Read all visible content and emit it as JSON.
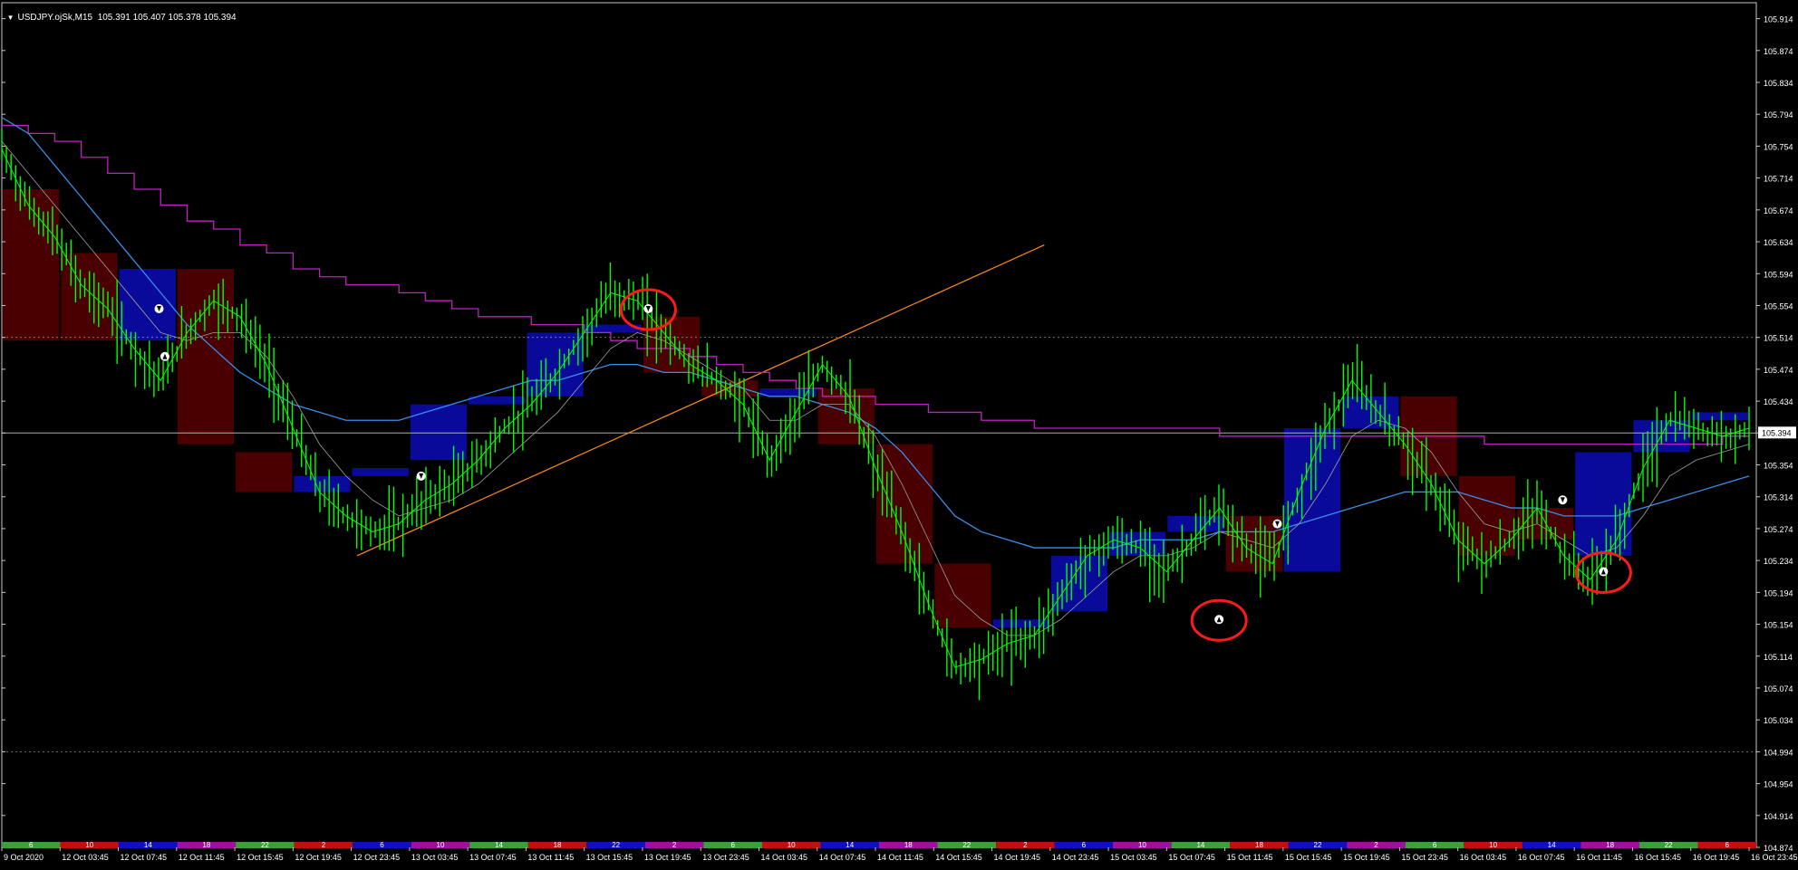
{
  "header": {
    "menu_arrow": "▼",
    "symbol": "USDJPY.ojSk,M15",
    "quote": "105.391 105.407 105.378 105.394"
  },
  "current_price_label": "105.394",
  "colors": {
    "background": "#000000",
    "frame": "#c8c8c8",
    "candle": "#00ff00",
    "bar_up": "#0a0a9a",
    "bar_down": "#4a0000",
    "pivot_line": "#c020c0",
    "blue_line": "#3a8ee8",
    "ma_line": "#a0a0a0",
    "trendline": "#ff8c1a",
    "price_line": "#c0c0c0",
    "marker_circle": "#ff1a1a",
    "session_colors": [
      "#3aa03a",
      "#c01010",
      "#1010c0",
      "#a010a0"
    ]
  },
  "session_strip_labels": [
    "6",
    "10",
    "14",
    "18",
    "22",
    "2",
    "6",
    "10",
    "14",
    "18",
    "22",
    "2",
    "6",
    "10",
    "14",
    "18",
    "22",
    "2",
    "6",
    "10",
    "14",
    "18",
    "22",
    "2",
    "6",
    "10",
    "14",
    "18",
    "22",
    "6"
  ],
  "chart_data": {
    "type": "line",
    "title": "USDJPY.ojSk,M15",
    "ohlc_current": {
      "open": 105.391,
      "high": 105.407,
      "low": 105.378,
      "close": 105.394
    },
    "y_ticks": [
      105.914,
      105.874,
      105.834,
      105.794,
      105.754,
      105.714,
      105.674,
      105.634,
      105.594,
      105.554,
      105.514,
      105.474,
      105.434,
      105.394,
      105.354,
      105.314,
      105.274,
      105.234,
      105.194,
      105.154,
      105.114,
      105.074,
      105.034,
      104.994,
      104.954,
      104.914,
      104.874
    ],
    "ylim": [
      104.874,
      105.934
    ],
    "x_ticks": [
      "9 Oct 2020",
      "12 Oct 03:45",
      "12 Oct 07:45",
      "12 Oct 11:45",
      "12 Oct 15:45",
      "12 Oct 19:45",
      "12 Oct 23:45",
      "13 Oct 03:45",
      "13 Oct 07:45",
      "13 Oct 11:45",
      "13 Oct 15:45",
      "13 Oct 19:45",
      "13 Oct 23:45",
      "14 Oct 03:45",
      "14 Oct 07:45",
      "14 Oct 11:45",
      "14 Oct 15:45",
      "14 Oct 19:45",
      "14 Oct 23:45",
      "15 Oct 03:45",
      "15 Oct 07:45",
      "15 Oct 11:45",
      "15 Oct 15:45",
      "15 Oct 19:45",
      "15 Oct 23:45",
      "16 Oct 03:45",
      "16 Oct 07:45",
      "16 Oct 11:45",
      "16 Oct 15:45",
      "16 Oct 19:45",
      "16 Oct 23:45"
    ],
    "series": [
      {
        "name": "price",
        "values": [
          105.75,
          105.68,
          105.64,
          105.58,
          105.55,
          105.5,
          105.46,
          105.52,
          105.56,
          105.54,
          105.48,
          105.4,
          105.32,
          105.29,
          105.27,
          105.28,
          105.31,
          105.33,
          105.36,
          105.4,
          105.43,
          105.47,
          105.52,
          105.57,
          105.56,
          105.52,
          105.48,
          105.46,
          105.43,
          105.36,
          105.42,
          105.48,
          105.44,
          105.35,
          105.27,
          105.18,
          105.1,
          105.11,
          105.13,
          105.14,
          105.19,
          105.24,
          105.26,
          105.25,
          105.22,
          105.26,
          105.3,
          105.25,
          105.23,
          105.32,
          105.4,
          105.46,
          105.42,
          105.38,
          105.33,
          105.26,
          105.23,
          105.26,
          105.3,
          105.24,
          105.21,
          105.26,
          105.35,
          105.41,
          105.4,
          105.39,
          105.4
        ]
      },
      {
        "name": "ma",
        "values": [
          105.76,
          105.72,
          105.68,
          105.64,
          105.6,
          105.56,
          105.52,
          105.51,
          105.52,
          105.52,
          105.49,
          105.44,
          105.38,
          105.34,
          105.31,
          105.29,
          105.3,
          105.31,
          105.33,
          105.36,
          105.39,
          105.42,
          105.46,
          105.5,
          105.52,
          105.51,
          105.49,
          105.47,
          105.45,
          105.41,
          105.41,
          105.43,
          105.43,
          105.39,
          105.33,
          105.26,
          105.19,
          105.16,
          105.14,
          105.14,
          105.16,
          105.19,
          105.22,
          105.24,
          105.24,
          105.25,
          105.27,
          105.26,
          105.25,
          105.28,
          105.33,
          105.39,
          105.41,
          105.4,
          105.37,
          105.32,
          105.28,
          105.27,
          105.28,
          105.26,
          105.24,
          105.25,
          105.29,
          105.34,
          105.36,
          105.37,
          105.38
        ]
      },
      {
        "name": "blue",
        "values": [
          105.79,
          105.77,
          105.73,
          105.69,
          105.65,
          105.61,
          105.57,
          105.53,
          105.5,
          105.47,
          105.45,
          105.43,
          105.42,
          105.41,
          105.41,
          105.41,
          105.42,
          105.43,
          105.44,
          105.45,
          105.46,
          105.46,
          105.47,
          105.48,
          105.48,
          105.47,
          105.47,
          105.46,
          105.45,
          105.44,
          105.44,
          105.43,
          105.42,
          105.4,
          105.37,
          105.33,
          105.29,
          105.27,
          105.26,
          105.25,
          105.25,
          105.25,
          105.25,
          105.26,
          105.26,
          105.26,
          105.27,
          105.27,
          105.27,
          105.28,
          105.29,
          105.3,
          105.31,
          105.32,
          105.32,
          105.32,
          105.31,
          105.3,
          105.3,
          105.29,
          105.29,
          105.29,
          105.3,
          105.31,
          105.32,
          105.33,
          105.34
        ]
      },
      {
        "name": "pivot",
        "values": [
          105.78,
          105.77,
          105.76,
          105.74,
          105.72,
          105.7,
          105.68,
          105.66,
          105.65,
          105.63,
          105.62,
          105.6,
          105.59,
          105.58,
          105.58,
          105.57,
          105.56,
          105.55,
          105.54,
          105.54,
          105.53,
          105.53,
          105.52,
          105.51,
          105.5,
          105.5,
          105.49,
          105.48,
          105.47,
          105.46,
          105.45,
          105.44,
          105.44,
          105.43,
          105.43,
          105.42,
          105.42,
          105.41,
          105.41,
          105.4,
          105.4,
          105.4,
          105.4,
          105.4,
          105.4,
          105.4,
          105.39,
          105.39,
          105.39,
          105.39,
          105.39,
          105.39,
          105.39,
          105.39,
          105.39,
          105.39,
          105.38,
          105.38,
          105.38,
          105.38,
          105.38,
          105.38,
          105.38,
          105.38,
          105.38,
          105.39,
          105.39
        ]
      }
    ],
    "session_boxes": [
      {
        "dir": "down",
        "open": 105.7,
        "close": 105.51
      },
      {
        "dir": "down",
        "open": 105.62,
        "close": 105.51
      },
      {
        "dir": "up",
        "open": 105.51,
        "close": 105.6
      },
      {
        "dir": "down",
        "open": 105.6,
        "close": 105.38
      },
      {
        "dir": "down",
        "open": 105.37,
        "close": 105.32
      },
      {
        "dir": "up",
        "open": 105.32,
        "close": 105.34
      },
      {
        "dir": "up",
        "open": 105.34,
        "close": 105.35
      },
      {
        "dir": "up",
        "open": 105.36,
        "close": 105.43
      },
      {
        "dir": "up",
        "open": 105.43,
        "close": 105.44
      },
      {
        "dir": "up",
        "open": 105.44,
        "close": 105.52
      },
      {
        "dir": "up",
        "open": 105.52,
        "close": 105.53
      },
      {
        "dir": "down",
        "open": 105.54,
        "close": 105.47
      },
      {
        "dir": "down",
        "open": 105.46,
        "close": 105.44
      },
      {
        "dir": "up",
        "open": 105.44,
        "close": 105.45
      },
      {
        "dir": "down",
        "open": 105.45,
        "close": 105.38
      },
      {
        "dir": "down",
        "open": 105.38,
        "close": 105.23
      },
      {
        "dir": "down",
        "open": 105.23,
        "close": 105.15
      },
      {
        "dir": "up",
        "open": 105.15,
        "close": 105.16
      },
      {
        "dir": "up",
        "open": 105.17,
        "close": 105.24
      },
      {
        "dir": "up",
        "open": 105.24,
        "close": 105.27
      },
      {
        "dir": "up",
        "open": 105.27,
        "close": 105.29
      },
      {
        "dir": "down",
        "open": 105.29,
        "close": 105.22
      },
      {
        "dir": "up",
        "open": 105.22,
        "close": 105.4
      },
      {
        "dir": "up",
        "open": 105.4,
        "close": 105.44
      },
      {
        "dir": "down",
        "open": 105.44,
        "close": 105.34
      },
      {
        "dir": "down",
        "open": 105.34,
        "close": 105.24
      },
      {
        "dir": "down",
        "open": 105.3,
        "close": 105.26
      },
      {
        "dir": "up",
        "open": 105.24,
        "close": 105.37
      },
      {
        "dir": "up",
        "open": 105.37,
        "close": 105.41
      },
      {
        "dir": "up",
        "open": 105.41,
        "close": 105.42
      }
    ],
    "trendline": {
      "from_index": 6.1,
      "from_price": 105.24,
      "to_index": 17.9,
      "to_price": 105.63
    },
    "horizontal_levels": [
      {
        "price": 105.514,
        "style": "dotted"
      },
      {
        "price": 105.394,
        "style": "solid"
      },
      {
        "price": 104.994,
        "style": "dotted"
      }
    ],
    "arrows": [
      {
        "index": 2.7,
        "price": 105.55,
        "dir": "down"
      },
      {
        "index": 2.8,
        "price": 105.49,
        "dir": "up"
      },
      {
        "index": 7.2,
        "price": 105.34,
        "dir": "down"
      },
      {
        "index": 11.1,
        "price": 105.55,
        "dir": "down",
        "circled": true
      },
      {
        "index": 20.9,
        "price": 105.16,
        "dir": "up",
        "circled": true
      },
      {
        "index": 21.9,
        "price": 105.28,
        "dir": "down"
      },
      {
        "index": 26.8,
        "price": 105.31,
        "dir": "down"
      },
      {
        "index": 27.5,
        "price": 105.22,
        "dir": "up",
        "circled": true
      }
    ],
    "grid": false,
    "legend": "none"
  }
}
